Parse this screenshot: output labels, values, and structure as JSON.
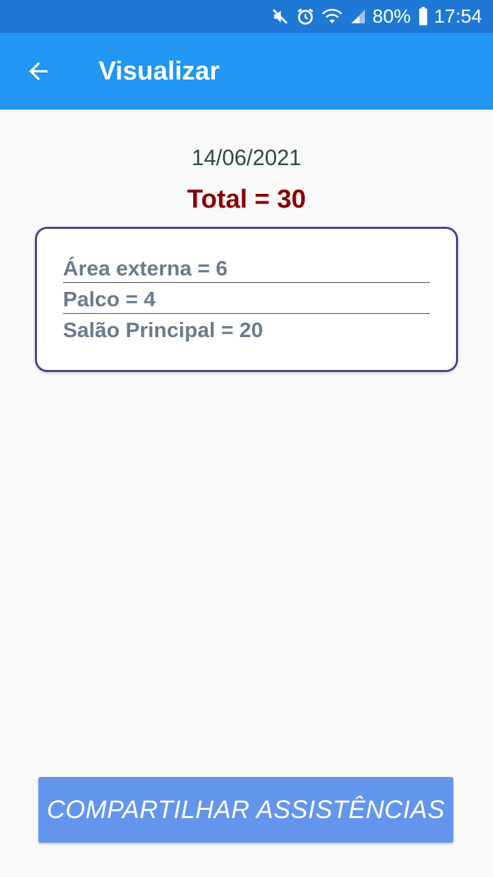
{
  "status_bar": {
    "icons": [
      "mute-icon",
      "alarm-icon",
      "wifi-icon",
      "signal-icon",
      "battery-icon"
    ],
    "battery": "80%",
    "time": "17:54"
  },
  "app_bar": {
    "back_icon": "arrow-left-icon",
    "title": "Visualizar"
  },
  "main": {
    "date": "14/06/2021",
    "total": "Total = 30",
    "areas": [
      {
        "label": "Área externa = 6"
      },
      {
        "label": "Palco = 4"
      },
      {
        "label": "Salão Principal = 20"
      }
    ]
  },
  "share_button": {
    "label": "COMPARTILHAR ASSISTÊNCIAS"
  },
  "colors": {
    "status_bar": "#1e78d6",
    "app_bar": "#2196f3",
    "total": "#8b0000",
    "card_border": "#4b3f8f",
    "button": "#6495ed"
  }
}
